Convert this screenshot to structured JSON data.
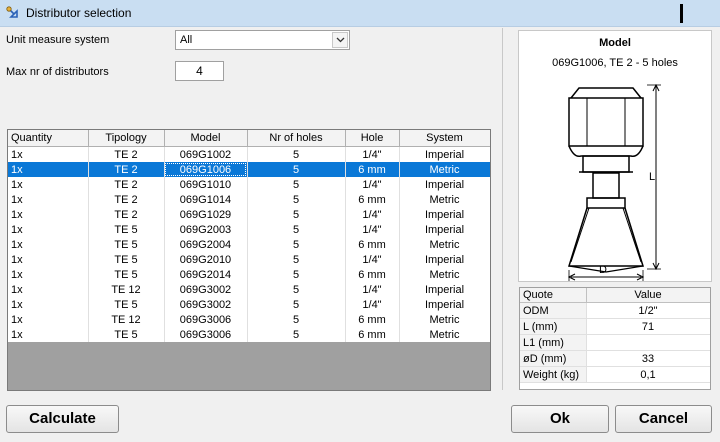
{
  "window": {
    "title": "Distributor selection"
  },
  "form": {
    "unit_label": "Unit measure system",
    "unit_value": "All",
    "max_label": "Max nr of distributors",
    "max_value": "4"
  },
  "grid": {
    "columns": [
      "Quantity",
      "Tipology",
      "Model",
      "Nr of holes",
      "Hole",
      "System"
    ],
    "selected_index": 1,
    "rows": [
      [
        "1x",
        "TE 2",
        "069G1002",
        "5",
        "1/4\"",
        "Imperial"
      ],
      [
        "1x",
        "TE 2",
        "069G1006",
        "5",
        "6 mm",
        "Metric"
      ],
      [
        "1x",
        "TE 2",
        "069G1010",
        "5",
        "1/4\"",
        "Imperial"
      ],
      [
        "1x",
        "TE 2",
        "069G1014",
        "5",
        "6 mm",
        "Metric"
      ],
      [
        "1x",
        "TE 2",
        "069G1029",
        "5",
        "1/4\"",
        "Imperial"
      ],
      [
        "1x",
        "TE 5",
        "069G2003",
        "5",
        "1/4\"",
        "Imperial"
      ],
      [
        "1x",
        "TE 5",
        "069G2004",
        "5",
        "6 mm",
        "Metric"
      ],
      [
        "1x",
        "TE 5",
        "069G2010",
        "5",
        "1/4\"",
        "Imperial"
      ],
      [
        "1x",
        "TE 5",
        "069G2014",
        "5",
        "6 mm",
        "Metric"
      ],
      [
        "1x",
        "TE 12",
        "069G3002",
        "5",
        "1/4\"",
        "Imperial"
      ],
      [
        "1x",
        "TE 5",
        "069G3002",
        "5",
        "1/4\"",
        "Imperial"
      ],
      [
        "1x",
        "TE 12",
        "069G3006",
        "5",
        "6 mm",
        "Metric"
      ],
      [
        "1x",
        "TE 5",
        "069G3006",
        "5",
        "6 mm",
        "Metric"
      ]
    ]
  },
  "model": {
    "title": "Model",
    "subtitle": "069G1006, TE 2 - 5 holes",
    "dim_length": "L",
    "dim_diameter": "D"
  },
  "quote": {
    "columns": [
      "Quote",
      "Value"
    ],
    "rows": [
      [
        "ODM",
        "1/2\""
      ],
      [
        "L (mm)",
        "71"
      ],
      [
        "L1 (mm)",
        ""
      ],
      [
        "øD (mm)",
        "33"
      ],
      [
        "Weight (kg)",
        "0,1"
      ]
    ]
  },
  "buttons": {
    "calculate": "Calculate",
    "ok": "Ok",
    "cancel": "Cancel"
  }
}
